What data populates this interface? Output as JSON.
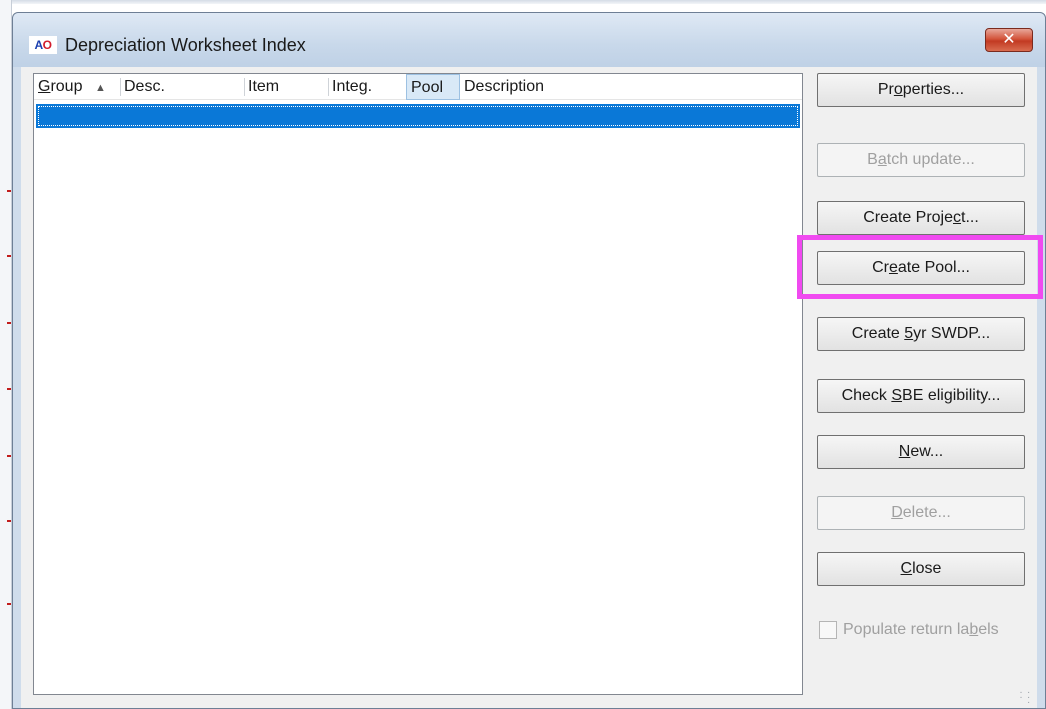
{
  "window": {
    "title": "Depreciation Worksheet Index",
    "icon_text_a": "A",
    "icon_text_o": "O",
    "close_glyph": "✕"
  },
  "list": {
    "columns": [
      {
        "label": "Group",
        "mnemonic": "G",
        "rest": "roup",
        "sort": "▲"
      },
      {
        "label": "Desc."
      },
      {
        "label": "Item"
      },
      {
        "label": "Integ."
      },
      {
        "label": "Pool"
      },
      {
        "label": "Description"
      }
    ]
  },
  "buttons": {
    "properties": {
      "pre": "Pr",
      "key": "o",
      "post": "perties..."
    },
    "batch_update": {
      "pre": "B",
      "key": "a",
      "post": "tch update..."
    },
    "create_project": {
      "pre": "Create Proje",
      "key": "c",
      "post": "t..."
    },
    "create_pool": {
      "pre": "Cr",
      "key": "e",
      "post": "ate Pool..."
    },
    "create_5yr": {
      "pre": "Create ",
      "key": "5",
      "post": "yr SWDP..."
    },
    "check_sbe": {
      "pre": "Check ",
      "key": "S",
      "post": "BE eligibility..."
    },
    "new": {
      "pre": "",
      "key": "N",
      "post": "ew..."
    },
    "delete": {
      "pre": "",
      "key": "D",
      "post": "elete..."
    },
    "close": {
      "pre": "",
      "key": "C",
      "post": "lose"
    }
  },
  "checkbox": {
    "pre": "Populate return la",
    "key": "b",
    "post": "els"
  },
  "colors": {
    "selection": "#0a78d7",
    "highlight": "#f04af0"
  }
}
